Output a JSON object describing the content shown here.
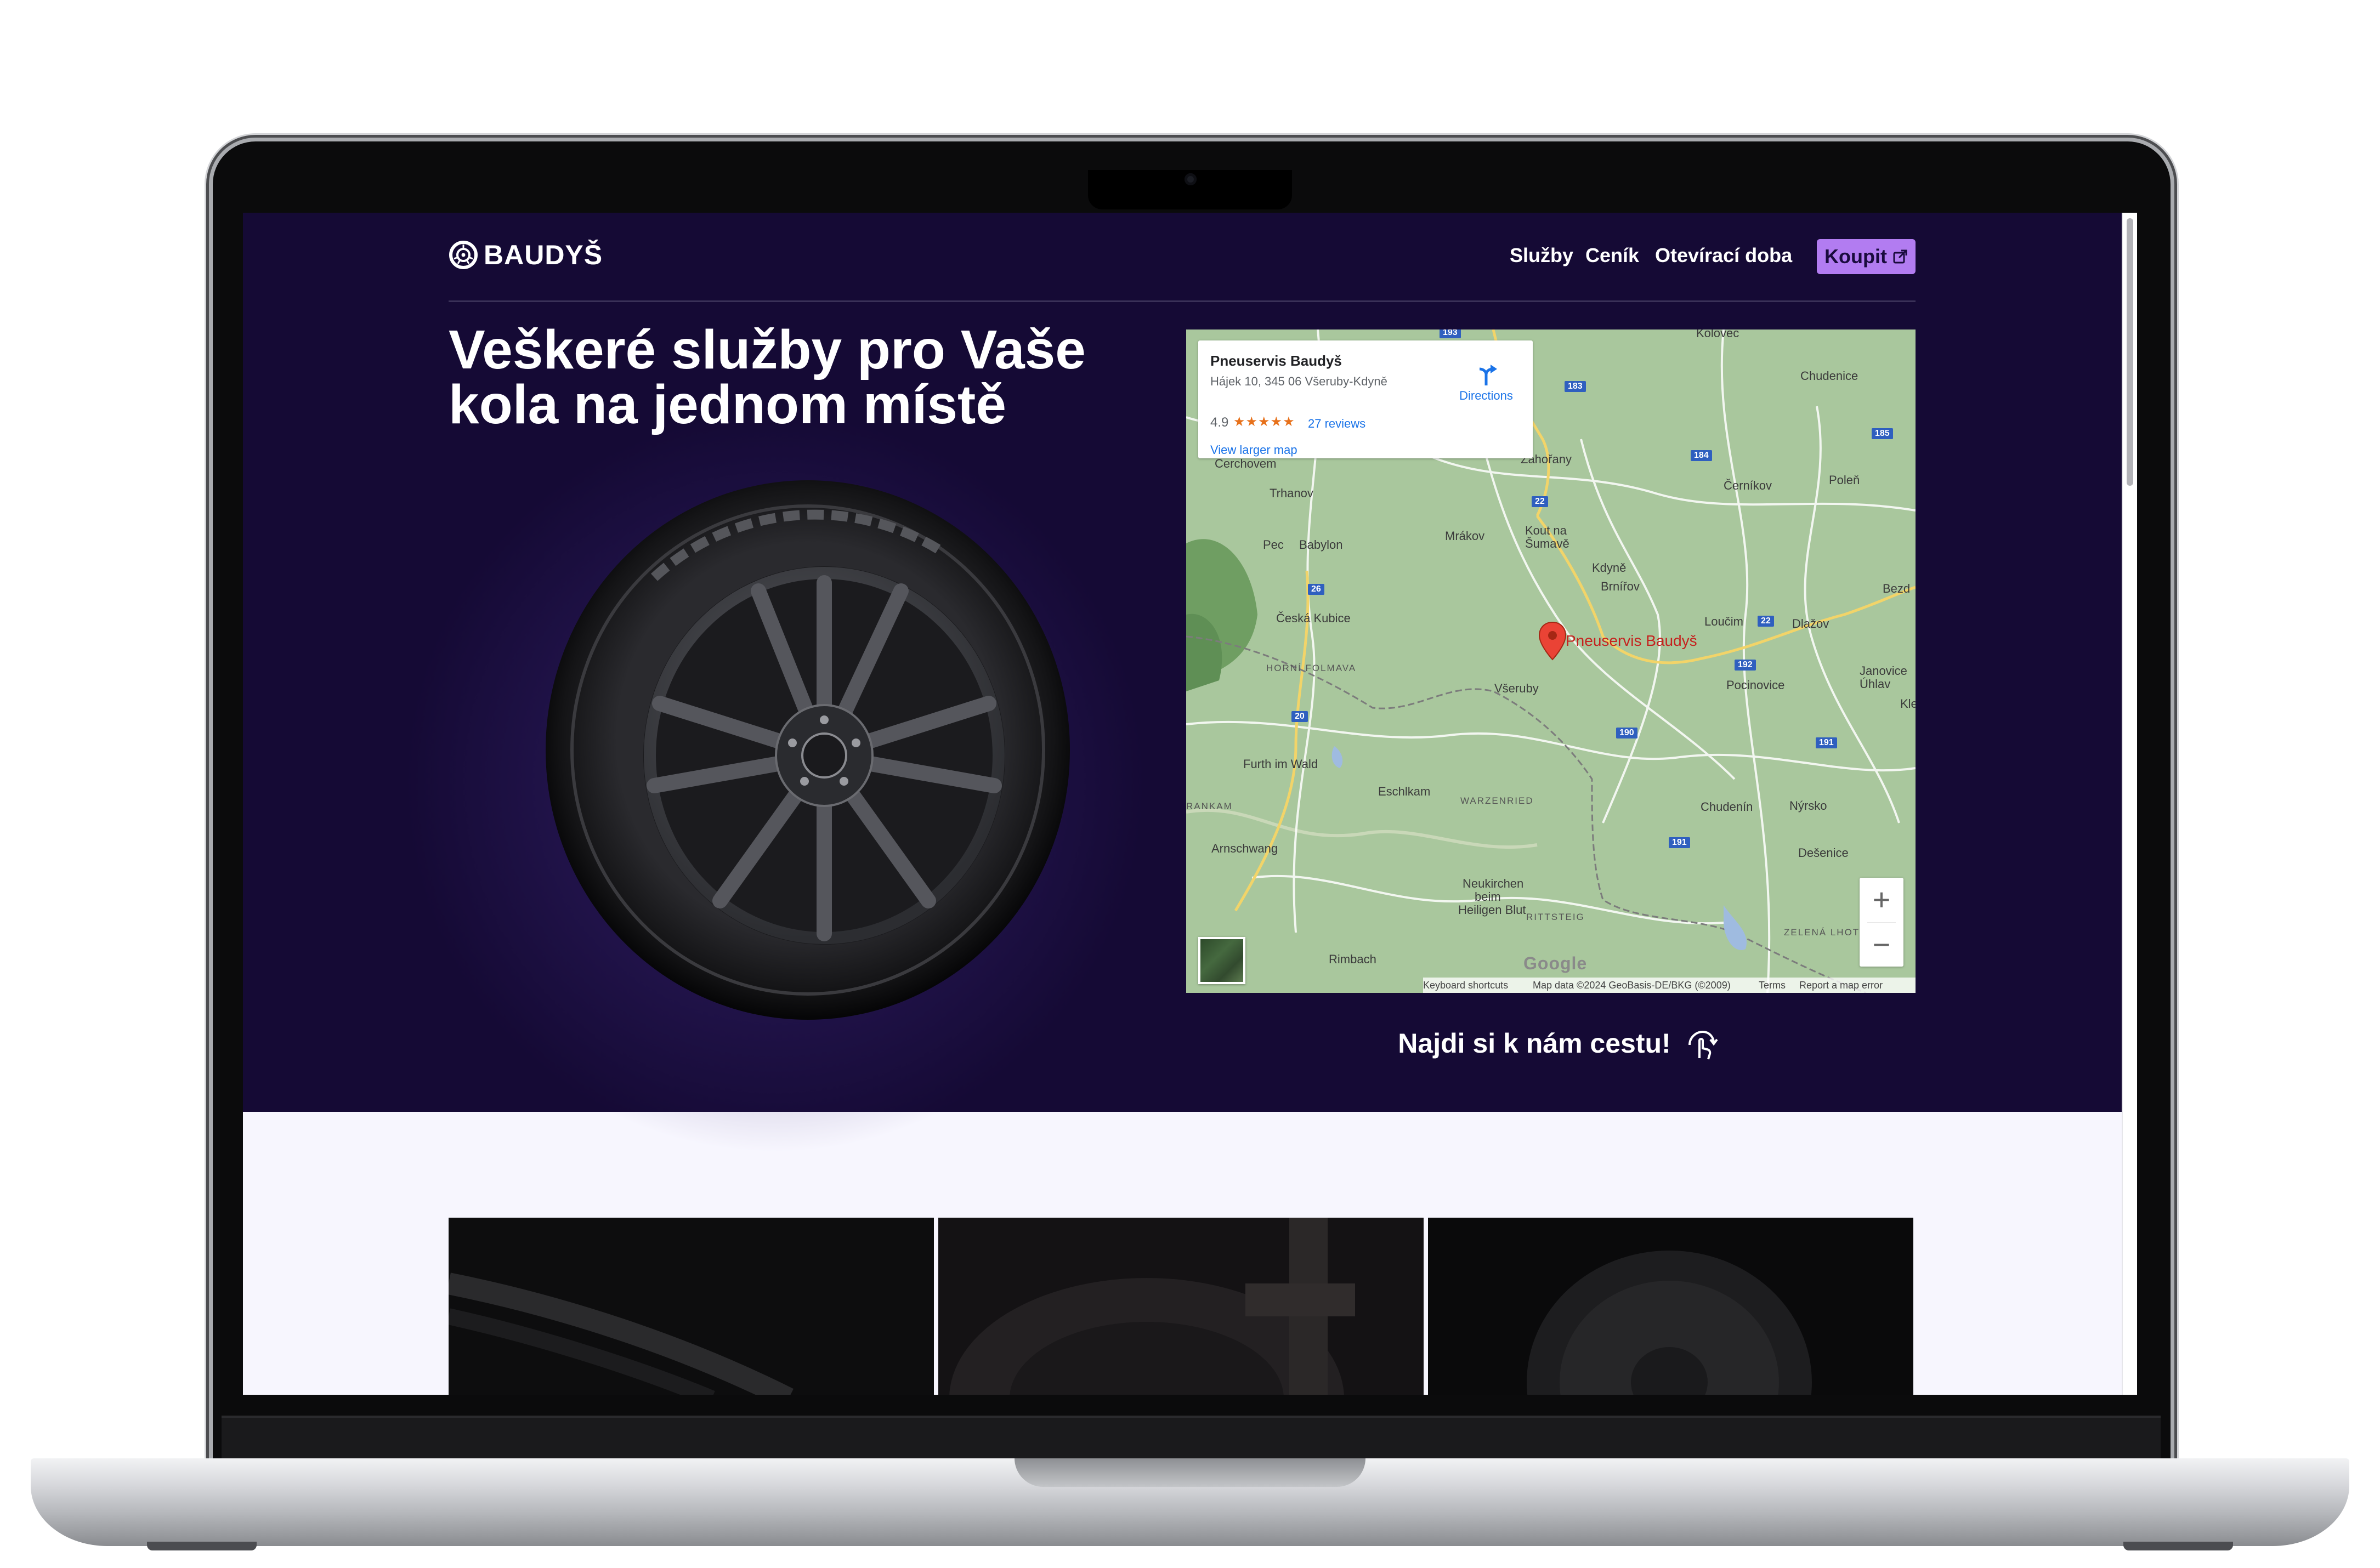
{
  "brand": {
    "name": "BAUDYŠ",
    "icon": "tire-logo-icon"
  },
  "nav": {
    "links": [
      "Služby",
      "Ceník",
      "Otevírací doba"
    ],
    "buy_label": "Koupit",
    "buy_icon": "external-link-icon"
  },
  "hero": {
    "title_line1": "Veškeré služby pro Vaše",
    "title_line2": "kola na jednom místě",
    "image": "wheel-image"
  },
  "map": {
    "place_name": "Pneuservis Baudyš",
    "address": "Hájek 10, 345 06 Všeruby-Kdyně",
    "rating": "4.9",
    "stars": "★★★★★",
    "reviews": "27 reviews",
    "directions_label": "Directions",
    "larger_map_label": "View larger map",
    "pin_label": "Pneuservis Baudyš",
    "towns": [
      "Chudenice",
      "Černíkov",
      "Poleň",
      "Zahořany",
      "Trhanov",
      "Mrákov",
      "Kout na",
      "Šumavě",
      "Pec",
      "Babylon",
      "Kdyně",
      "Brnířov",
      "Bezd",
      "Česká Kubice",
      "Loučim",
      "Dlažov",
      "Všeruby",
      "Janovice",
      "Úhlav",
      "Kle",
      "Pocinovice",
      "Furth im Wald",
      "Eschlkam",
      "Chudenín",
      "Nýrsko",
      "Arnschwang",
      "Dešenice",
      "Neukirchen",
      "beim",
      "Heiligen Blut",
      "Rimbach",
      "Cerchovem",
      "Kolovec"
    ],
    "areas": [
      "HORNÍ FOLMAVA",
      "WARZENRIED",
      "RITTSTEIG",
      "ZELENÁ LHOT",
      "RANKAM"
    ],
    "roads": [
      "193",
      "183",
      "185",
      "184",
      "22",
      "26",
      "22",
      "192",
      "20",
      "190",
      "191",
      "191"
    ],
    "zoom_in": "+",
    "zoom_out": "−",
    "google": "Google",
    "attribution": [
      "Keyboard shortcuts",
      "Map data ©2024 GeoBasis-DE/BKG (©2009)",
      "Terms",
      "Report a map error"
    ]
  },
  "find_us": {
    "label": "Najdi si k nám cestu!",
    "icon": "touch-gesture-icon"
  },
  "services_cards": [
    "tire-close-up-photo",
    "tire-mounting-photo",
    "steel-wheel-photo"
  ],
  "colors": {
    "hero_bg": "#150a35",
    "accent": "#b27cf1",
    "page_bg": "#f7f6fe",
    "pin": "#c5221f"
  }
}
